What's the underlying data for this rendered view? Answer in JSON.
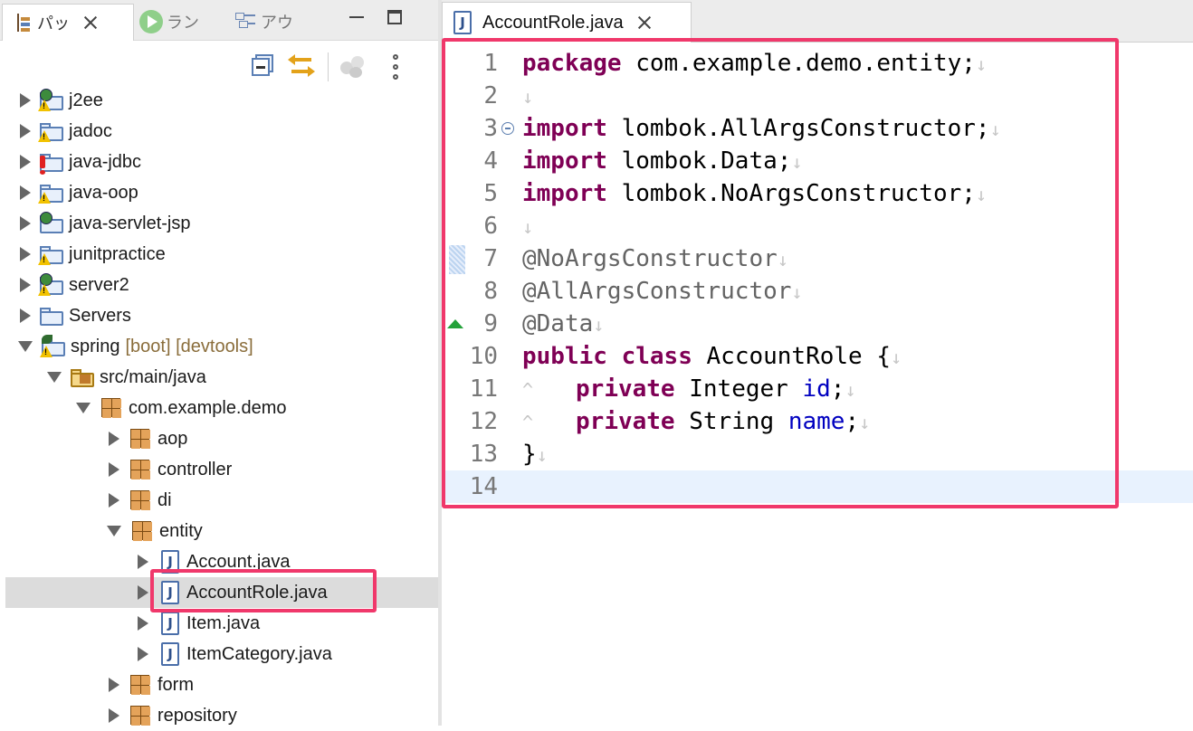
{
  "left_panel": {
    "tabs": [
      {
        "label": "パッ",
        "icon": "package-explorer-icon"
      },
      {
        "label": "ラン",
        "icon": "run-icon"
      },
      {
        "label": "アウ",
        "icon": "outline-icon"
      }
    ]
  },
  "tree": {
    "items": [
      {
        "label": "j2ee"
      },
      {
        "label": "jadoc"
      },
      {
        "label": "java-jdbc"
      },
      {
        "label": "java-oop"
      },
      {
        "label": "java-servlet-jsp"
      },
      {
        "label": "junitpractice"
      },
      {
        "label": "server2"
      },
      {
        "label": "Servers"
      },
      {
        "label": "spring",
        "decoration": "[boot] [devtools]"
      },
      {
        "label": "src/main/java"
      },
      {
        "label": "com.example.demo"
      },
      {
        "label": "aop"
      },
      {
        "label": "controller"
      },
      {
        "label": "di"
      },
      {
        "label": "entity"
      },
      {
        "label": "Account.java"
      },
      {
        "label": "AccountRole.java"
      },
      {
        "label": "Item.java"
      },
      {
        "label": "ItemCategory.java"
      },
      {
        "label": "form"
      },
      {
        "label": "repository"
      }
    ]
  },
  "editor": {
    "tab_label": "AccountRole.java",
    "line_numbers": [
      "1",
      "2",
      "3",
      "4",
      "5",
      "6",
      "7",
      "8",
      "9",
      "10",
      "11",
      "12",
      "13",
      "14"
    ],
    "tokens": {
      "package": "package",
      "pkg_name": " com.example.demo.entity;",
      "import": "import",
      "imp1": " lombok.AllArgsConstructor;",
      "imp2": " lombok.Data;",
      "imp3": " lombok.NoArgsConstructor;",
      "ann1": "@NoArgsConstructor",
      "ann2": "@AllArgsConstructor",
      "ann3": "@Data",
      "public": "public",
      "class": "class",
      "class_name": " AccountRole {",
      "tab_mark": "^",
      "private": "private",
      "type_integer": " Integer ",
      "field_id": "id",
      "type_string": " String ",
      "field_name": "name",
      "semicolon": ";",
      "close_brace": "}",
      "newline_mark": "↓"
    }
  },
  "colors": {
    "highlight": "#f0386b",
    "keyword": "#7f0055",
    "annotation": "#646464",
    "field": "#0000c0"
  }
}
